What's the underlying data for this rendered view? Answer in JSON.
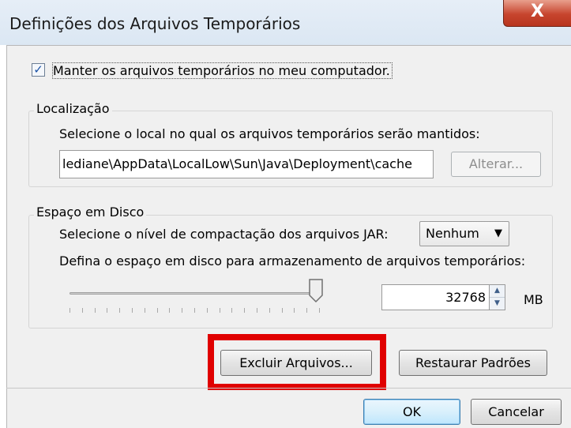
{
  "window": {
    "title": "Definições dos Arquivos Temporários",
    "close_label": "X"
  },
  "keep_files": {
    "checked": true,
    "check_mark": "✓",
    "label": "Manter os arquivos temporários no meu computador."
  },
  "location": {
    "legend": "Localização",
    "instruction": "Selecione o local no qual os arquivos temporários serão mantidos:",
    "path": "lediane\\AppData\\LocalLow\\Sun\\Java\\Deployment\\cache",
    "change_label": "Alterar..."
  },
  "disk_space": {
    "legend": "Espaço em Disco",
    "compression_label": "Selecione o nível de compactação dos arquivos JAR:",
    "compression_value": "Nenhum",
    "dropdown_arrow": "▼",
    "space_label": "Defina o espaço em disco para armazenamento de arquivos temporários:",
    "slider_level": 1.0,
    "size_value": "32768",
    "size_unit": "MB",
    "spin_up": "▲",
    "spin_down": "▼"
  },
  "actions": {
    "delete_files_label": "Excluir Arquivos...",
    "restore_defaults_label": "Restaurar Padrões",
    "ok_label": "OK",
    "cancel_label": "Cancelar"
  },
  "colors": {
    "highlight": "#e00000",
    "close_button": "#c7452e"
  }
}
